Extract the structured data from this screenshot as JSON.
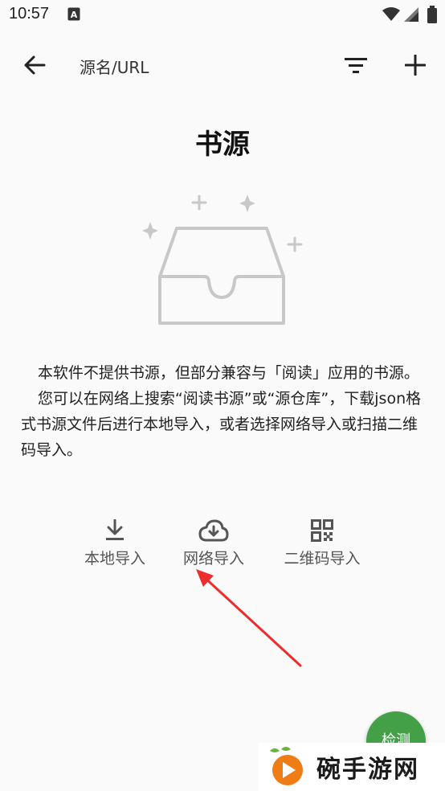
{
  "status_bar": {
    "time": "10:57",
    "notification_icon": "a-notification-icon",
    "wifi_icon": "wifi-icon",
    "signal_icon": "signal-icon",
    "battery_icon": "battery-icon"
  },
  "toolbar": {
    "back_icon": "arrow-back-icon",
    "title": "源名/URL",
    "filter_icon": "filter-icon",
    "add_icon": "plus-icon"
  },
  "empty_state": {
    "title": "书源",
    "illustration": "empty-inbox-tray-with-sparkles",
    "paragraph1": "本软件不提供书源，但部分兼容与「阅读」应用的书源。",
    "paragraph2": "您可以在网络上搜索“阅读书源”或“源仓库”，下载json格式书源文件后进行本地导入，或者选择网络导入或扫描二维码导入。"
  },
  "actions": {
    "local": {
      "label": "本地导入",
      "icon": "download-icon"
    },
    "network": {
      "label": "网络导入",
      "icon": "cloud-download-icon"
    },
    "qrcode": {
      "label": "二维码导入",
      "icon": "qr-code-icon"
    }
  },
  "annotation": {
    "arrow_color": "#ee2c2c"
  },
  "fab": {
    "label": "检测",
    "color": "#43a047"
  },
  "watermark": {
    "text": "碗手游网",
    "logo": "carrot-play-logo"
  }
}
